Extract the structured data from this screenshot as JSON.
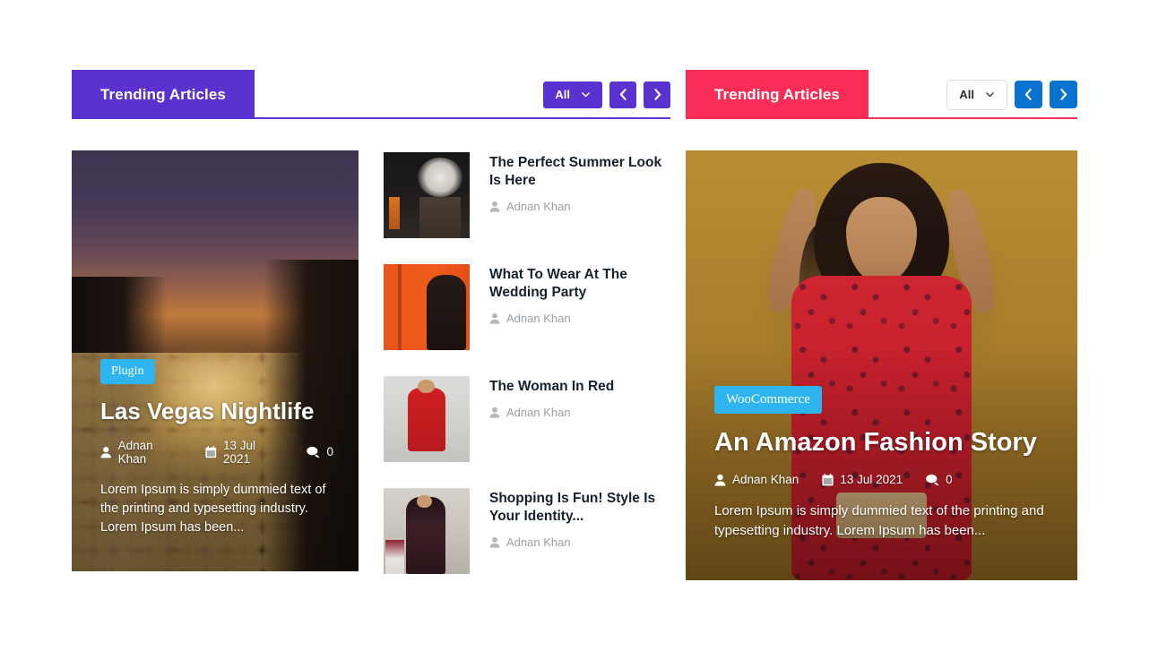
{
  "widgets": [
    {
      "id": "trending-articles-purple",
      "title": "Trending Articles",
      "accent_color": "#5a32d0",
      "controls": {
        "filter_label": "All",
        "filter_icon": "chevron-down-icon",
        "prev_label": "‹",
        "next_label": "›",
        "prev_icon": "chevron-left-icon",
        "next_icon": "chevron-right-icon"
      },
      "featured": {
        "badge": "Plugin",
        "badge_color": "#2eb5f0",
        "title": "Las Vegas Nightlife",
        "author": "Adnan Khan",
        "date": "13 Jul 2021",
        "comments": "0",
        "excerpt": "Lorem Ipsum is simply dummied text of the printing and typesetting industry. Lorem Ipsum has been..."
      },
      "posts": [
        {
          "title": "The Perfect Summer Look Is Here",
          "author": "Adnan Khan"
        },
        {
          "title": "What To Wear At The Wedding Party",
          "author": "Adnan Khan"
        },
        {
          "title": "The Woman In Red",
          "author": "Adnan Khan"
        },
        {
          "title": "Shopping Is Fun! Style Is Your Identity...",
          "author": "Adnan Khan"
        }
      ]
    },
    {
      "id": "trending-articles-pink",
      "title": "Trending Articles",
      "accent_color": "#fa2d57",
      "button_color": "#0a73d0",
      "controls": {
        "filter_label": "All",
        "filter_icon": "chevron-down-icon",
        "prev_label": "‹",
        "next_label": "›",
        "prev_icon": "chevron-left-icon",
        "next_icon": "chevron-right-icon"
      },
      "featured": {
        "badge": "WooCommerce",
        "badge_color": "#2eb5f0",
        "title": "An Amazon Fashion Story",
        "author": "Adnan Khan",
        "date": "13 Jul 2021",
        "comments": "0",
        "excerpt": "Lorem Ipsum is simply dummied text of the printing and typesetting industry. Lorem Ipsum has been..."
      }
    }
  ]
}
